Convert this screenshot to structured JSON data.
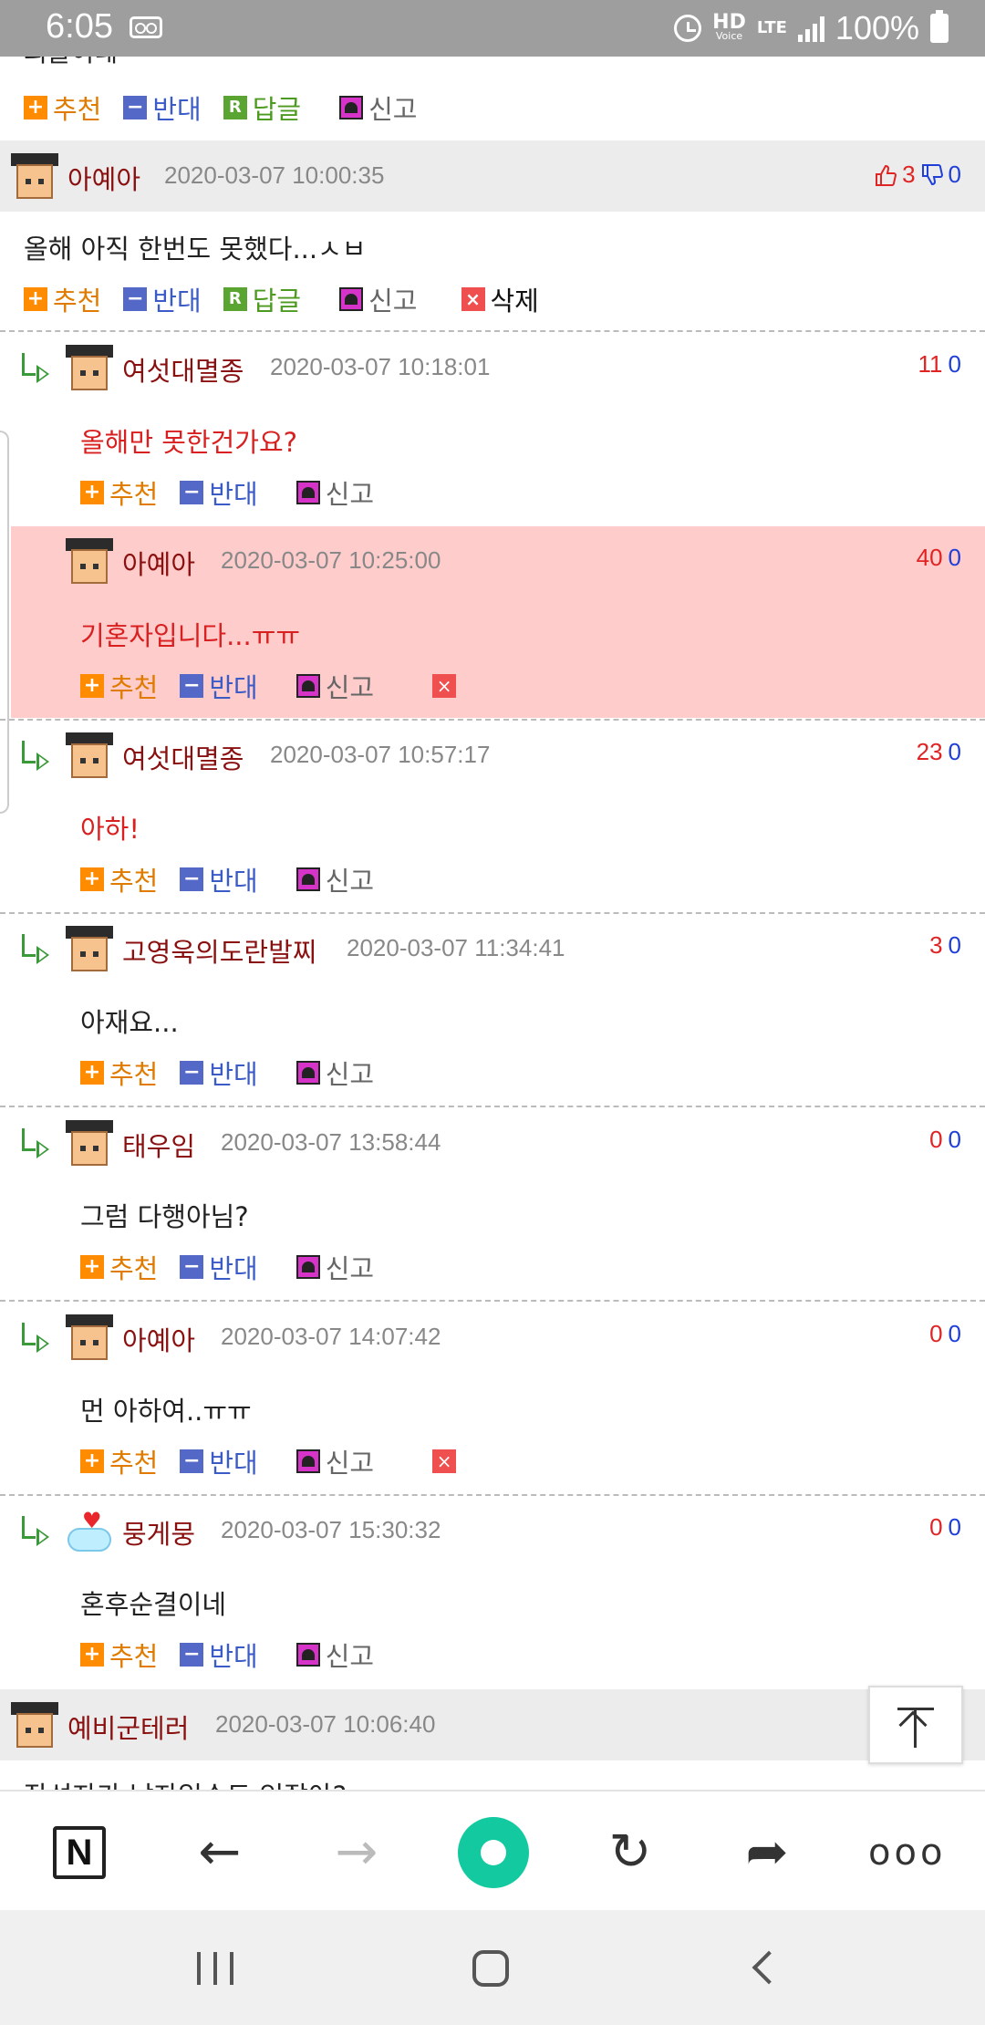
{
  "status_bar": {
    "time": "6:05",
    "hd_label": "HD",
    "hd_sub": "Voice",
    "lte_label": "LTE",
    "battery": "100%"
  },
  "actions_labels": {
    "recommend": "추천",
    "oppose": "반대",
    "reply": "답글",
    "report": "신고",
    "delete": "삭제",
    "reply_icon": "R"
  },
  "partial_top_text": "괴물이네",
  "comments": [
    {
      "user": "아예아",
      "date": "2020-03-07 10:00:35",
      "up": "3",
      "down": "0",
      "text": "올해 아직 한번도 못했다...ㅅㅂ"
    },
    {
      "user": "여섯대멸종",
      "date": "2020-03-07 10:18:01",
      "up": "11",
      "down": "0",
      "text": "올해만 못한건가요?"
    },
    {
      "user": "아예아",
      "date": "2020-03-07 10:25:00",
      "up": "40",
      "down": "0",
      "text": "기혼자입니다...ㅠㅠ"
    },
    {
      "user": "여섯대멸종",
      "date": "2020-03-07 10:57:17",
      "up": "23",
      "down": "0",
      "text": "아하!"
    },
    {
      "user": "고영욱의도란발찌",
      "date": "2020-03-07 11:34:41",
      "up": "3",
      "down": "0",
      "text": "아재요..."
    },
    {
      "user": "태우임",
      "date": "2020-03-07 13:58:44",
      "up": "0",
      "down": "0",
      "text": "그럼 다행아님?"
    },
    {
      "user": "아예아",
      "date": "2020-03-07 14:07:42",
      "up": "0",
      "down": "0",
      "text": "먼 아하여..ㅠㅠ"
    },
    {
      "user": "뭉게뭉",
      "date": "2020-03-07 15:30:32",
      "up": "0",
      "down": "0",
      "text": "혼후순결이네"
    },
    {
      "user": "예비군테러",
      "date": "2020-03-07 10:06:40",
      "text": "작성자가 남자일수도 있잖아?"
    }
  ],
  "browser_bar": {
    "n_logo": "N",
    "back_icon": "←",
    "forward_icon": "→",
    "refresh_icon": "↻",
    "share_icon": "➦",
    "more_icon": "ooo"
  },
  "colors": {
    "highlight": "#ffcccc",
    "username": "#8a1010",
    "up_vote": "#e02424",
    "down_vote": "#1f3fd6",
    "accent_green": "#13c9a0"
  }
}
